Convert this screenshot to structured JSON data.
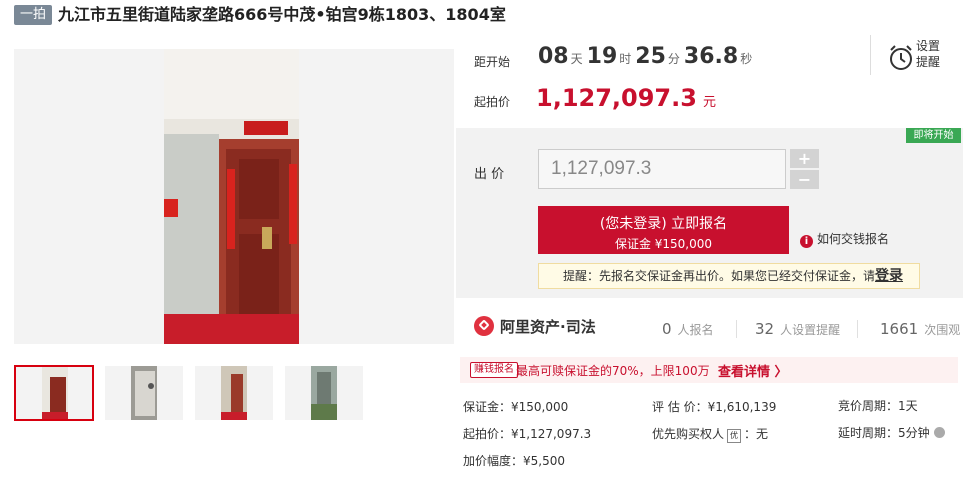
{
  "header": {
    "round_badge": "一拍",
    "title": "九江市五里街道陆家垄路666号中茂•铂宫9栋1803、1804室"
  },
  "gallery": {
    "thumbnails": [
      "thumb-entrance-door",
      "thumb-bathroom",
      "thumb-hallway",
      "thumb-building-exterior"
    ],
    "selected_index": 0
  },
  "auction": {
    "countdown_label": "距开始",
    "countdown": {
      "days": "08",
      "days_unit": "天",
      "hours": "19",
      "hours_unit": "时",
      "minutes": "25",
      "minutes_unit": "分",
      "seconds": "36.8",
      "seconds_unit": "秒"
    },
    "start_price_label": "起拍价",
    "start_price": "1,127,097.3",
    "price_unit": "元",
    "remind_line1": "设置",
    "remind_line2": "提醒",
    "status_badge": "即将开始"
  },
  "bid": {
    "label": "出 价",
    "value": "1,127,097.3",
    "plus": "+",
    "minus": "−",
    "signup_line1": "(您未登录) 立即报名",
    "signup_line2": "保证金 ¥150,000",
    "pay_help": "如何交钱报名",
    "tip_text": "提醒：先报名交保证金再出价。如果您已经交付保证金，请",
    "tip_link": "登录"
  },
  "stats": {
    "brand": "阿里资产·司法",
    "signups_value": "0",
    "signups_label": "人报名",
    "reminders_value": "32",
    "reminders_label": "人设置提醒",
    "views_value": "1661",
    "views_label": "次围观"
  },
  "promo": {
    "tag": "赚钱报名",
    "text": "最高可赎保证金的70%，上限100万",
    "link": "查看详情 〉"
  },
  "details": {
    "deposit": "保证金：¥150,000",
    "appraisal": "评 估 价：¥1,610,139",
    "cycle": "竞价周期：1天",
    "start_price": "起拍价：¥1,127,097.3",
    "priority_label": "优先购买权人",
    "priority_badge": "优",
    "priority_value": "：无",
    "delay": "延时周期：5分钟",
    "increment": "加价幅度：¥5,500"
  },
  "colors": {
    "accent": "#c8102e",
    "badge_bg": "#7a8896",
    "status_green": "#3aa854"
  }
}
